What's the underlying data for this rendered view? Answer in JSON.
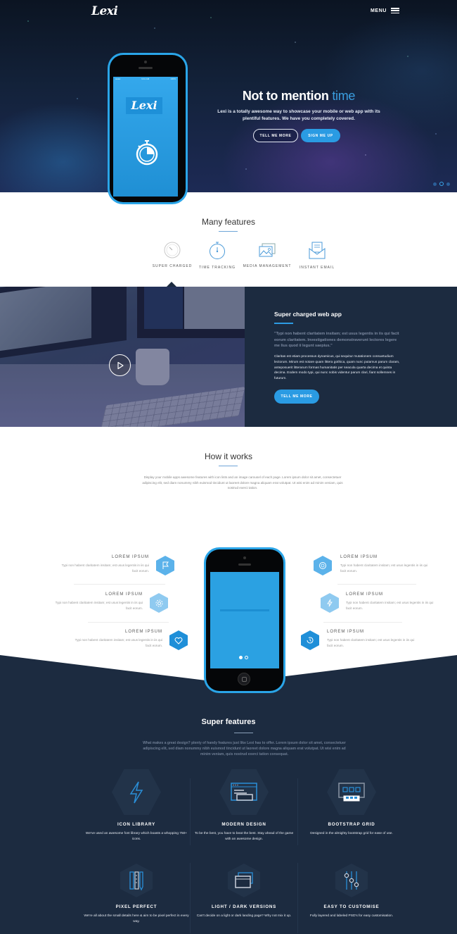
{
  "header": {
    "logo": "Lexi",
    "menu_label": "MENU"
  },
  "hero": {
    "title_main": "Not to mention",
    "title_accent": "time",
    "subtitle": "Lexi is a totally awesome way to showcase your mobile or web app with its plentiful features. We have you completely covered.",
    "btn_more": "TELL ME MORE",
    "btn_signup": "SIGN ME UP",
    "phone_logo": "Lexi",
    "slides": 3,
    "active_slide": 2
  },
  "features": {
    "title": "Many features",
    "tabs": [
      {
        "label": "SUPER CHARGED",
        "icon": "speedometer-icon"
      },
      {
        "label": "TIME TRACKING",
        "icon": "stopwatch-icon"
      },
      {
        "label": "MEDIA MANAGEMENT",
        "icon": "image-gallery-icon"
      },
      {
        "label": "INSTANT EMAIL",
        "icon": "envelope-icon"
      }
    ],
    "active_tab": 0
  },
  "supercharged": {
    "title": "Super charged web app",
    "quote": "\"Typi non habent claritatem insitam; est usus legentis in iis qui facit eorum claritatem. Investigationes demonstraverunt lectores legere me lius quod ii legunt saepius.\"",
    "body": "Claritas est etiam processus dynamicus, qui sequitur mutationem consuetudium lectorum. Mirum est notare quam littera gothica, quam nunc putamus parum claram, anteposuerit litterarum formas humanitatis per seacula quarta decima et quinta decima. Eodem modo typi, qui nunc nobis videntur parum clari, fiant sollemnes in futurum.",
    "button": "TELL ME MORE"
  },
  "how": {
    "title": "How it works",
    "description": "Display your mobile apps awesome features with icon lists and an image carousel of each page. Lorem ipsum dolor sit amet, consectetuer adipiscing elit, sed diam nonummy nibh euismod tincidunt ut laoreet dolore magna aliquam erat volutpat. Ut wisi enim ad minim veniam, quis nostrud exerci tation.",
    "left_items": [
      {
        "title": "LOREM IPSUM",
        "text": "Typi non habent claritatem insitam; est usus legentis in iis qui facit eorum.",
        "icon": "flag-icon"
      },
      {
        "title": "LOREM IPSUM",
        "text": "Typi non habent claritatem insitam; est usus legentis in iis qui facit eorum.",
        "icon": "gear-icon"
      },
      {
        "title": "LOREM IPSUM",
        "text": "Typi non habent claritatem insitam; est usus legentis in iis qui facit eorum.",
        "icon": "heart-icon"
      }
    ],
    "right_items": [
      {
        "title": "LOREM IPSUM",
        "text": "Typi non habent claritatem insitam; est usus legentis in iis qui facit eorum.",
        "icon": "aperture-icon"
      },
      {
        "title": "LOREM IPSUM",
        "text": "Typi non habent claritatem insitam; est usus legentis in iis qui facit eorum.",
        "icon": "lightning-icon"
      },
      {
        "title": "LOREM IPSUM",
        "text": "Typi non habent claritatem insitam; est usus legentis in iis qui facit eorum.",
        "icon": "clock-refresh-icon"
      }
    ],
    "carousel_pages": 2,
    "carousel_active": 1
  },
  "super_features": {
    "title": "Super features",
    "description": "What makes a great design? plenty of handy features just like Lexi has to offer. Lorem ipsum dolor sit amet, consectetuer adipiscing elit, sed diam nonummy nibh euismod tincidunt ut laoreet dolore magna aliquam erat volutpat. Ut wisi enim ad minim veniam, quis nostrud exerci tation consequat.",
    "items": [
      {
        "title": "ICON LIBRARY",
        "text": "We've used an awesome font library which boasts a whopping 750+ icons.",
        "icon": "lightning-bolt-icon"
      },
      {
        "title": "MODERN DESIGN",
        "text": "To be the best, you have to beat the best. Stay ahead of the game with an awesome design.",
        "icon": "browser-layout-icon"
      },
      {
        "title": "BOOTSTRAP GRID",
        "text": "Designed in the almighty bootstrap grid for ease of use.",
        "icon": "grid-icon"
      },
      {
        "title": "PIXEL PERFECT",
        "text": "We're all about the small details here & aim to be pixel perfect in every way.",
        "icon": "ruler-pencil-icon"
      },
      {
        "title": "LIGHT / DARK VERSIONS",
        "text": "Can't decide on a light or dark landing page? Why not mix it up.",
        "icon": "windows-icon"
      },
      {
        "title": "EASY TO CUSTOMISE",
        "text": "Fully layered and labeled PSD's for easy customisation.",
        "icon": "sliders-icon"
      }
    ]
  },
  "colors": {
    "accent": "#2a9be3",
    "dark_navy": "#1c2b40",
    "text_gray": "#999999"
  }
}
